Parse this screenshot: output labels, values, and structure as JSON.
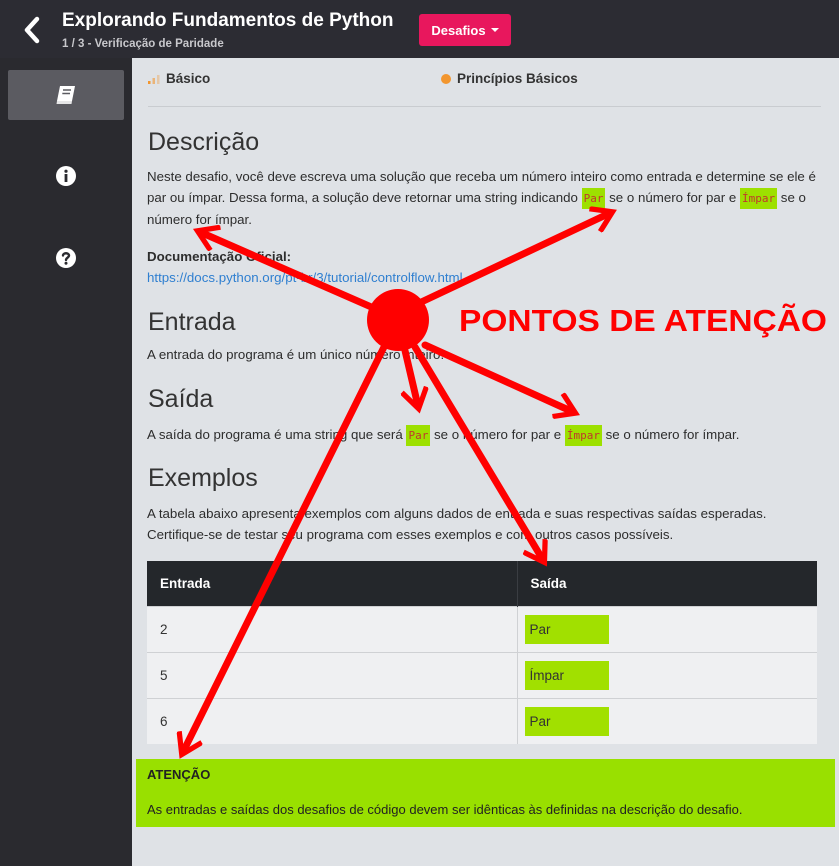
{
  "header": {
    "title": "Explorando Fundamentos de Python",
    "subtitle": "1 / 3 - Verificação de Paridade",
    "menu_button": "Desafios"
  },
  "sidebar": {
    "items": [
      {
        "icon": "book-icon",
        "active": true
      },
      {
        "icon": "info-icon",
        "active": false
      },
      {
        "icon": "question-icon",
        "active": false
      }
    ]
  },
  "meta": {
    "level": "Básico",
    "category": "Princípios Básicos"
  },
  "description": {
    "heading": "Descrição",
    "text_1": "Neste desafio, você deve escreva uma solução que receba um número inteiro como entrada e determine se ele é par ou ímpar. Dessa forma, a solução deve retornar uma string indicando ",
    "code_1": "Par",
    "text_2": " se o número for par e ",
    "code_2": "Ímpar",
    "text_3": " se o número for ímpar.",
    "doc_label": "Documentação Oficial:",
    "doc_link": "https://docs.python.org/pt-br/3/tutorial/controlflow.html"
  },
  "input_section": {
    "heading": "Entrada",
    "text": "A entrada do programa é um único número inteiro."
  },
  "output_section": {
    "heading": "Saída",
    "text_1": "A saída do programa é uma string que será ",
    "code_1": "Par",
    "text_2": " se o número for par e ",
    "code_2": "Ímpar",
    "text_3": " se o número for ímpar."
  },
  "examples": {
    "heading": "Exemplos",
    "text": "A tabela abaixo apresenta exemplos com alguns dados de entrada e suas respectivas saídas esperadas. Certifique-se de testar seu programa com esses exemplos e com outros casos possíveis.",
    "columns": [
      "Entrada",
      "Saída"
    ],
    "rows": [
      {
        "input": "2",
        "output": "Par"
      },
      {
        "input": "5",
        "output": "Ímpar"
      },
      {
        "input": "6",
        "output": "Par"
      }
    ]
  },
  "alert": {
    "title": "ATENÇÃO",
    "text": "As entradas e saídas dos desafios de código devem ser idênticas às definidas na descrição do desafio."
  },
  "annotation": {
    "label": "PONTOS DE ATENÇÃO",
    "color": "#ff0000"
  },
  "colors": {
    "accent": "#e8175d",
    "highlight": "#9de000",
    "topbar": "#2c2c33"
  }
}
